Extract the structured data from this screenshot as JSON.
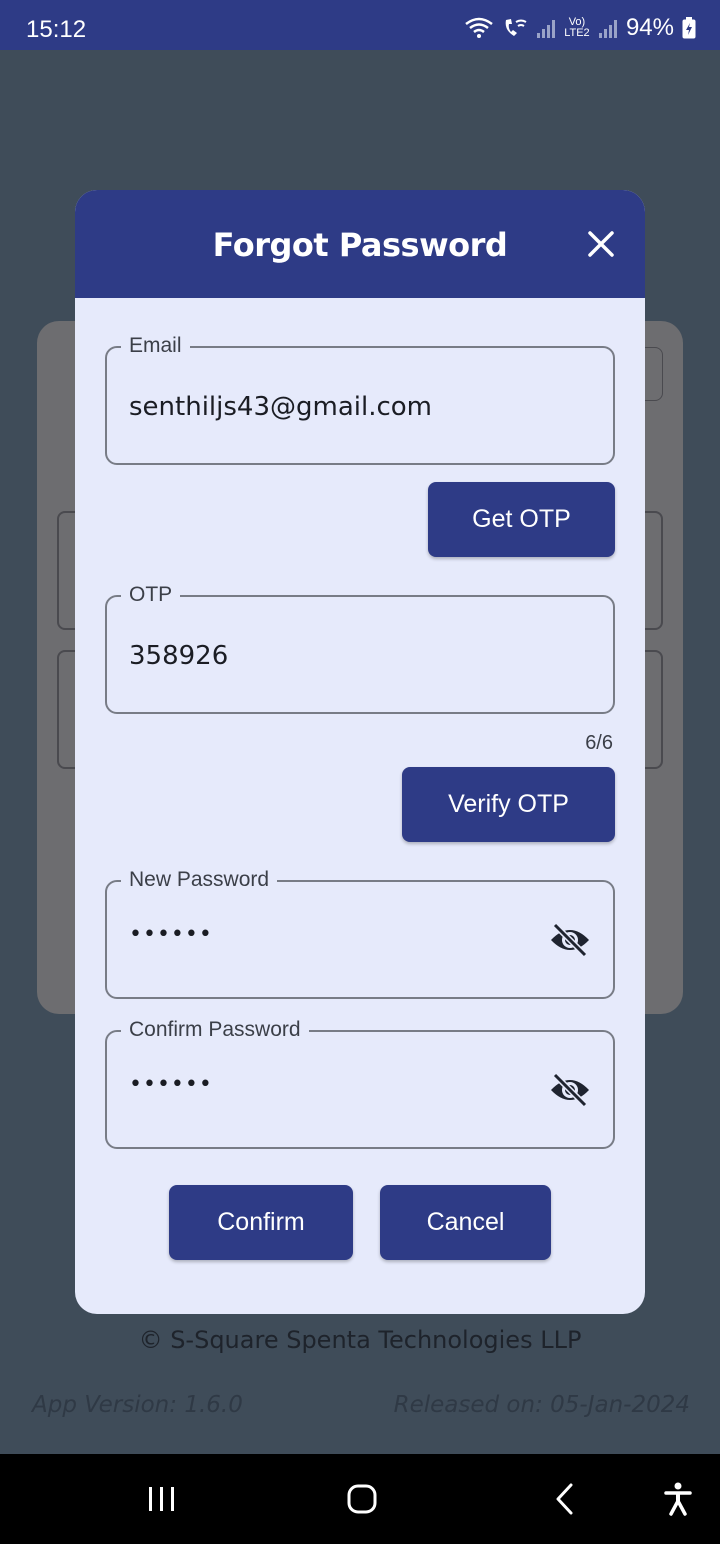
{
  "status_bar": {
    "time": "15:12",
    "lte_label": "Vo) LTE2",
    "battery": "94%"
  },
  "dialog": {
    "title": "Forgot Password",
    "email": {
      "label": "Email",
      "value": "senthiljs43@gmail.com"
    },
    "get_otp_label": "Get OTP",
    "otp": {
      "label": "OTP",
      "value": "358926",
      "counter": "6/6"
    },
    "verify_otp_label": "Verify OTP",
    "new_password": {
      "label": "New Password",
      "value": "••••••"
    },
    "confirm_password": {
      "label": "Confirm Password",
      "value": "••••••"
    },
    "confirm_label": "Confirm",
    "cancel_label": "Cancel"
  },
  "footer": {
    "copyright": "© S-Square Spenta Technologies LLP",
    "app_version": "App Version: 1.6.0",
    "released_on": "Released on: 05-Jan-2024"
  },
  "colors": {
    "primary": "#2e3b86",
    "dialog_bg": "#e6eafb",
    "scrim": "#3f4c59"
  },
  "icons": {
    "close": "close-icon",
    "eye": "eye-off-icon",
    "wifi": "wifi-icon",
    "call": "wifi-call-icon",
    "signal": "signal-icon",
    "battery": "battery-charging-icon",
    "nav_recent": "recent-apps-icon",
    "nav_home": "home-icon",
    "nav_back": "back-icon",
    "nav_accessibility": "accessibility-icon"
  }
}
